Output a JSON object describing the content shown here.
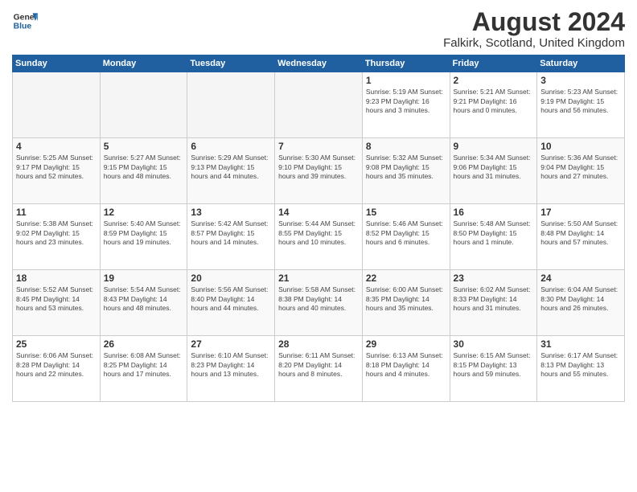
{
  "header": {
    "logo_general": "General",
    "logo_blue": "Blue",
    "month_year": "August 2024",
    "location": "Falkirk, Scotland, United Kingdom"
  },
  "weekdays": [
    "Sunday",
    "Monday",
    "Tuesday",
    "Wednesday",
    "Thursday",
    "Friday",
    "Saturday"
  ],
  "weeks": [
    [
      {
        "day": "",
        "empty": true
      },
      {
        "day": "",
        "empty": true
      },
      {
        "day": "",
        "empty": true
      },
      {
        "day": "",
        "empty": true
      },
      {
        "day": "1",
        "info": "Sunrise: 5:19 AM\nSunset: 9:23 PM\nDaylight: 16 hours\nand 3 minutes."
      },
      {
        "day": "2",
        "info": "Sunrise: 5:21 AM\nSunset: 9:21 PM\nDaylight: 16 hours\nand 0 minutes."
      },
      {
        "day": "3",
        "info": "Sunrise: 5:23 AM\nSunset: 9:19 PM\nDaylight: 15 hours\nand 56 minutes."
      }
    ],
    [
      {
        "day": "4",
        "info": "Sunrise: 5:25 AM\nSunset: 9:17 PM\nDaylight: 15 hours\nand 52 minutes."
      },
      {
        "day": "5",
        "info": "Sunrise: 5:27 AM\nSunset: 9:15 PM\nDaylight: 15 hours\nand 48 minutes."
      },
      {
        "day": "6",
        "info": "Sunrise: 5:29 AM\nSunset: 9:13 PM\nDaylight: 15 hours\nand 44 minutes."
      },
      {
        "day": "7",
        "info": "Sunrise: 5:30 AM\nSunset: 9:10 PM\nDaylight: 15 hours\nand 39 minutes."
      },
      {
        "day": "8",
        "info": "Sunrise: 5:32 AM\nSunset: 9:08 PM\nDaylight: 15 hours\nand 35 minutes."
      },
      {
        "day": "9",
        "info": "Sunrise: 5:34 AM\nSunset: 9:06 PM\nDaylight: 15 hours\nand 31 minutes."
      },
      {
        "day": "10",
        "info": "Sunrise: 5:36 AM\nSunset: 9:04 PM\nDaylight: 15 hours\nand 27 minutes."
      }
    ],
    [
      {
        "day": "11",
        "info": "Sunrise: 5:38 AM\nSunset: 9:02 PM\nDaylight: 15 hours\nand 23 minutes."
      },
      {
        "day": "12",
        "info": "Sunrise: 5:40 AM\nSunset: 8:59 PM\nDaylight: 15 hours\nand 19 minutes."
      },
      {
        "day": "13",
        "info": "Sunrise: 5:42 AM\nSunset: 8:57 PM\nDaylight: 15 hours\nand 14 minutes."
      },
      {
        "day": "14",
        "info": "Sunrise: 5:44 AM\nSunset: 8:55 PM\nDaylight: 15 hours\nand 10 minutes."
      },
      {
        "day": "15",
        "info": "Sunrise: 5:46 AM\nSunset: 8:52 PM\nDaylight: 15 hours\nand 6 minutes."
      },
      {
        "day": "16",
        "info": "Sunrise: 5:48 AM\nSunset: 8:50 PM\nDaylight: 15 hours\nand 1 minute."
      },
      {
        "day": "17",
        "info": "Sunrise: 5:50 AM\nSunset: 8:48 PM\nDaylight: 14 hours\nand 57 minutes."
      }
    ],
    [
      {
        "day": "18",
        "info": "Sunrise: 5:52 AM\nSunset: 8:45 PM\nDaylight: 14 hours\nand 53 minutes."
      },
      {
        "day": "19",
        "info": "Sunrise: 5:54 AM\nSunset: 8:43 PM\nDaylight: 14 hours\nand 48 minutes."
      },
      {
        "day": "20",
        "info": "Sunrise: 5:56 AM\nSunset: 8:40 PM\nDaylight: 14 hours\nand 44 minutes."
      },
      {
        "day": "21",
        "info": "Sunrise: 5:58 AM\nSunset: 8:38 PM\nDaylight: 14 hours\nand 40 minutes."
      },
      {
        "day": "22",
        "info": "Sunrise: 6:00 AM\nSunset: 8:35 PM\nDaylight: 14 hours\nand 35 minutes."
      },
      {
        "day": "23",
        "info": "Sunrise: 6:02 AM\nSunset: 8:33 PM\nDaylight: 14 hours\nand 31 minutes."
      },
      {
        "day": "24",
        "info": "Sunrise: 6:04 AM\nSunset: 8:30 PM\nDaylight: 14 hours\nand 26 minutes."
      }
    ],
    [
      {
        "day": "25",
        "info": "Sunrise: 6:06 AM\nSunset: 8:28 PM\nDaylight: 14 hours\nand 22 minutes."
      },
      {
        "day": "26",
        "info": "Sunrise: 6:08 AM\nSunset: 8:25 PM\nDaylight: 14 hours\nand 17 minutes."
      },
      {
        "day": "27",
        "info": "Sunrise: 6:10 AM\nSunset: 8:23 PM\nDaylight: 14 hours\nand 13 minutes."
      },
      {
        "day": "28",
        "info": "Sunrise: 6:11 AM\nSunset: 8:20 PM\nDaylight: 14 hours\nand 8 minutes."
      },
      {
        "day": "29",
        "info": "Sunrise: 6:13 AM\nSunset: 8:18 PM\nDaylight: 14 hours\nand 4 minutes."
      },
      {
        "day": "30",
        "info": "Sunrise: 6:15 AM\nSunset: 8:15 PM\nDaylight: 13 hours\nand 59 minutes."
      },
      {
        "day": "31",
        "info": "Sunrise: 6:17 AM\nSunset: 8:13 PM\nDaylight: 13 hours\nand 55 minutes."
      }
    ]
  ]
}
